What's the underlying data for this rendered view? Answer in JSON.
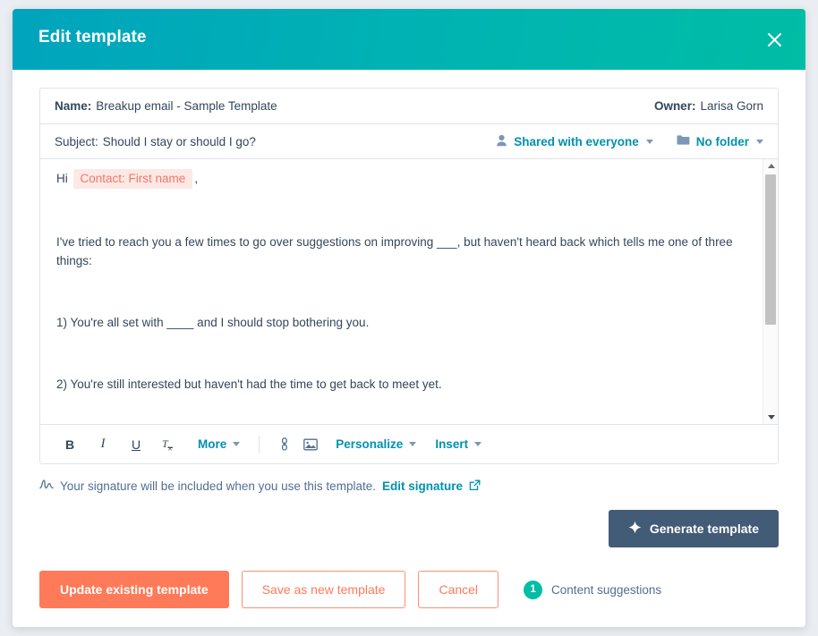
{
  "colors": {
    "header_gradient_start": "#00a4bd",
    "header_gradient_end": "#00bda5",
    "primary_orange": "#ff7a59",
    "link_teal": "#0091ae",
    "generate_slate": "#425b76",
    "badge_green": "#00bda5",
    "token_bg": "#fde9e4",
    "token_text": "#f2766b"
  },
  "header": {
    "title": "Edit template",
    "close_icon": "close-icon"
  },
  "template": {
    "name_label": "Name:",
    "name_value": "Breakup email - Sample Template",
    "owner_label": "Owner:",
    "owner_value": "Larisa Gorn",
    "subject_label": "Subject:",
    "subject_value": "Should I stay or should I go?",
    "sharing": {
      "icon": "person-icon",
      "label": "Shared with everyone"
    },
    "folder": {
      "icon": "folder-icon",
      "label": "No folder"
    }
  },
  "editor": {
    "greeting_prefix": "Hi",
    "token": "Contact: First name",
    "greeting_suffix": ",",
    "paragraphs": [
      "I've tried to reach you a few times to go over suggestions on improving ___, but haven't heard back which tells me one of three things:",
      "1) You're all set with ____ and I should stop bothering you.",
      "2) You're still interested but haven't had the time to get back to meet yet."
    ],
    "scrollbar": {
      "up_icon": "scroll-up-arrow-icon",
      "down_icon": "scroll-down-arrow-icon"
    }
  },
  "toolbar": {
    "bold": "B",
    "italic": "I",
    "underline": "U",
    "clear_format": "Tx",
    "more_label": "More",
    "link_icon": "link-icon",
    "image_icon": "image-icon",
    "personalize_label": "Personalize",
    "insert_label": "Insert"
  },
  "signature": {
    "icon": "signature-icon",
    "text": "Your signature will be included when you use this template.",
    "link_label": "Edit signature",
    "external_icon": "external-link-icon"
  },
  "generate": {
    "icon": "sparkle-icon",
    "label": "Generate template"
  },
  "footer": {
    "update_label": "Update existing template",
    "save_new_label": "Save as new template",
    "cancel_label": "Cancel",
    "suggestions_count": "1",
    "suggestions_label": "Content suggestions"
  }
}
